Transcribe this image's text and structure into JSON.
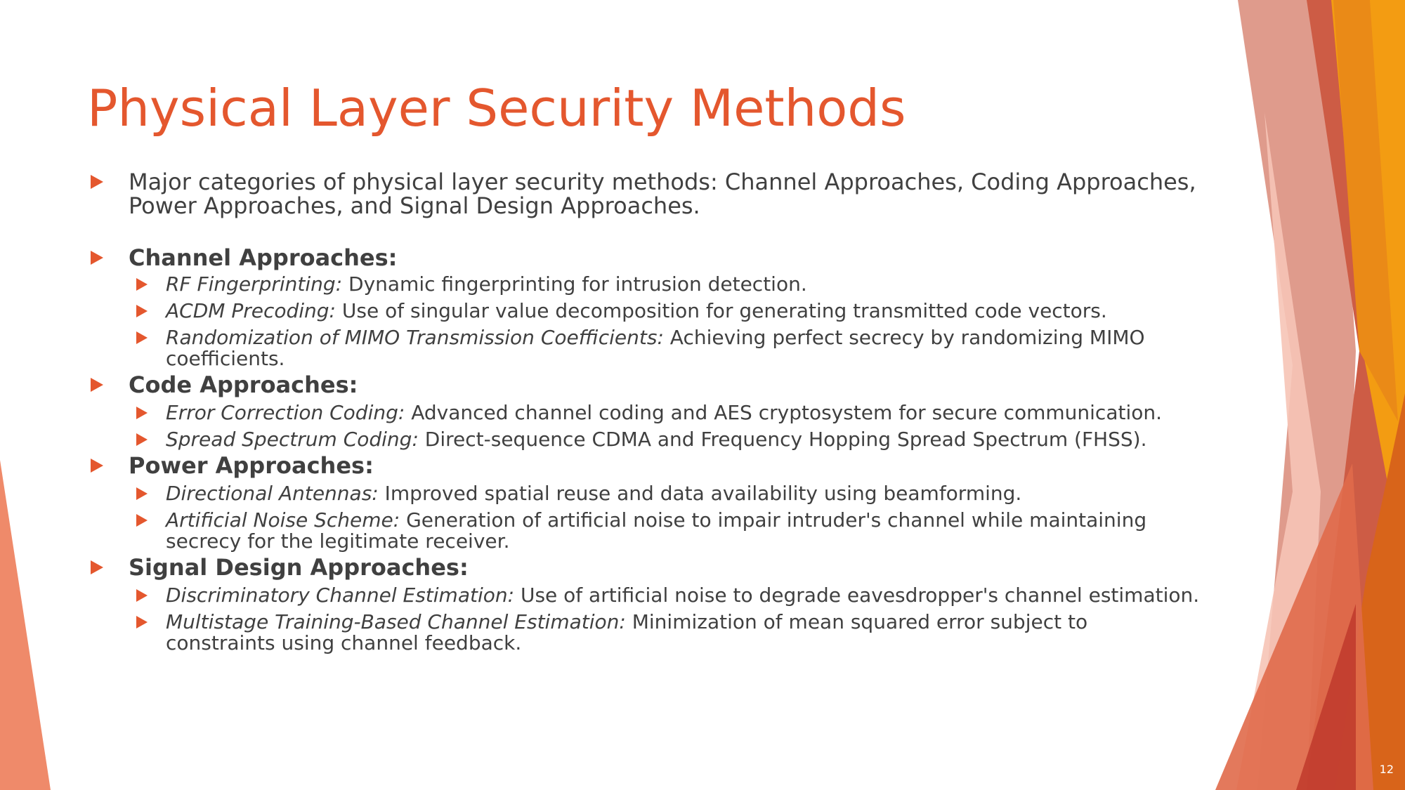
{
  "slide": {
    "title": "Physical Layer Security Methods",
    "page_number": "12"
  },
  "intro": {
    "text": "Major categories of physical layer security methods: Channel Approaches, Coding Approaches, Power Approaches, and Signal Design Approaches."
  },
  "channel": {
    "heading": "Channel Approaches:",
    "items": [
      {
        "term": "RF Fingerprinting:",
        "desc": " Dynamic fingerprinting for intrusion detection."
      },
      {
        "term": "ACDM Precoding:",
        "desc": " Use of singular value decomposition for generating transmitted code vectors."
      },
      {
        "term": "Randomization of MIMO Transmission Coefficients:",
        "desc": " Achieving perfect secrecy by randomizing MIMO coefficients."
      }
    ]
  },
  "code": {
    "heading": "Code Approaches:",
    "items": [
      {
        "term": "Error Correction Coding:",
        "desc": " Advanced channel coding and AES cryptosystem for secure communication."
      },
      {
        "term": "Spread Spectrum Coding:",
        "desc": " Direct-sequence CDMA and Frequency Hopping Spread Spectrum (FHSS)."
      }
    ]
  },
  "power": {
    "heading": "Power Approaches:",
    "items": [
      {
        "term": "Directional Antennas:",
        "desc": " Improved spatial reuse and data availability using beamforming."
      },
      {
        "term": "Artificial Noise Scheme:",
        "desc": " Generation of artificial noise to impair intruder's channel while maintaining secrecy for the legitimate receiver."
      }
    ]
  },
  "signal": {
    "heading": "Signal Design Approaches:",
    "items": [
      {
        "term": "Discriminatory Channel Estimation:",
        "desc": " Use of artificial noise to degrade eavesdropper's channel estimation."
      },
      {
        "term": "Multistage Training-Based Channel Estimation:",
        "desc": " Minimization of mean squared error subject to constraints using channel feedback."
      }
    ]
  },
  "theme_colors": {
    "title": "#e4572e",
    "bullet": "#e4572e",
    "body_text": "#404040",
    "accent_orange": "#f39c12",
    "accent_red": "#d4553a",
    "accent_salmon": "#ef8a6a"
  }
}
